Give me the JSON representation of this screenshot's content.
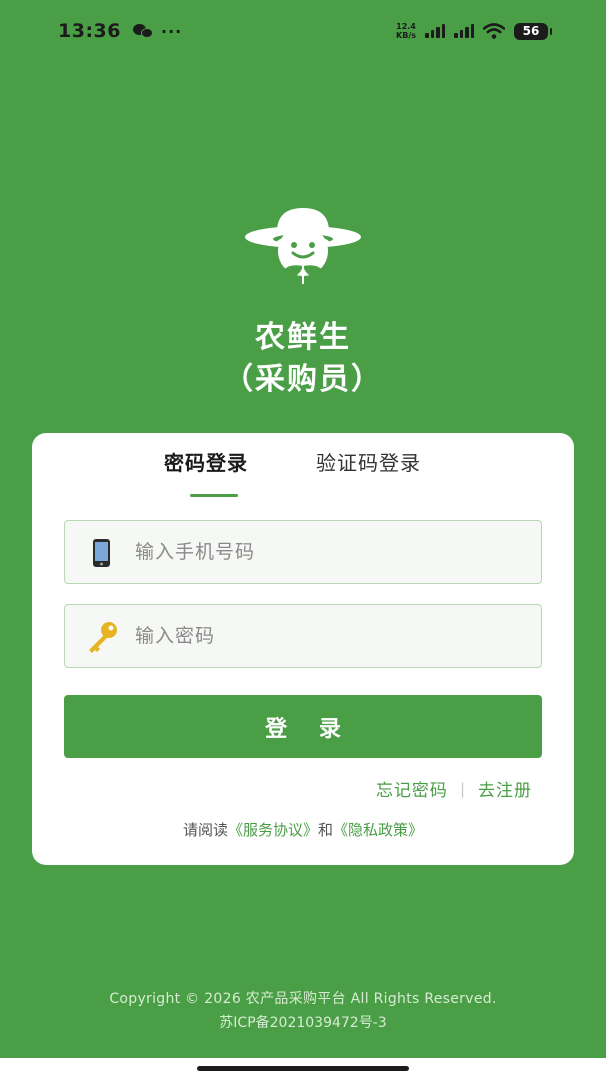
{
  "status_bar": {
    "time": "13:36",
    "notification_icons": [
      "wechat-icon",
      "more-dots-icon"
    ],
    "dots": "···",
    "net_speed_value": "12.4",
    "net_speed_unit": "KB/s",
    "battery": "56"
  },
  "app": {
    "logo": "farmer-hat-smiley-leaf-logo",
    "title": "农鲜生",
    "subtitle": "（采购员）"
  },
  "login": {
    "tabs": [
      {
        "label": "密码登录",
        "active": true
      },
      {
        "label": "验证码登录",
        "active": false
      }
    ],
    "phone_placeholder": "输入手机号码",
    "phone_icon": "mobile-phone-icon",
    "password_placeholder": "输入密码",
    "password_icon": "key-icon",
    "login_button": "登 录",
    "forgot_password": "忘记密码",
    "separator": "|",
    "register": "去注册",
    "agreement_prefix": "请阅读",
    "service_agreement": "《服务协议》",
    "agreement_and": "和",
    "privacy_policy": "《隐私政策》"
  },
  "footer": {
    "copyright": "Copyright © 2026 农产品采购平台 All Rights Reserved.",
    "icp": "苏ICP备2021039472号-3"
  },
  "colors": {
    "brand_green": "#4a9e45",
    "card_bg": "#ffffff",
    "input_bg": "#f6f8f5"
  }
}
